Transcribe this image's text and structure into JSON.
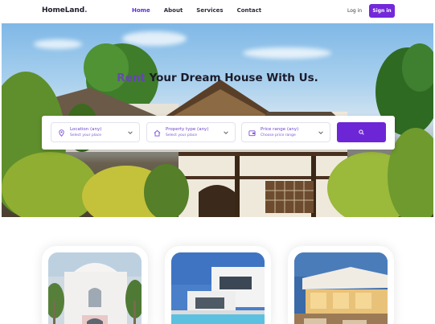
{
  "header": {
    "logo": "HomeLand",
    "nav": [
      {
        "label": "Home",
        "active": true
      },
      {
        "label": "About",
        "active": false
      },
      {
        "label": "Services",
        "active": false
      },
      {
        "label": "Contact",
        "active": false
      }
    ],
    "login_label": "Log in",
    "signin_label": "Sign in"
  },
  "hero": {
    "title_accent": "Rent",
    "title_rest": " Your Dream House With Us."
  },
  "search": {
    "fields": [
      {
        "label": "Location (any)",
        "sub": "Select your place",
        "icon": "location-pin-icon"
      },
      {
        "label": "Property type (any)",
        "sub": "Select your place",
        "icon": "home-icon"
      },
      {
        "label": "Price range (any)",
        "sub": "Choose price range",
        "icon": "wallet-icon"
      }
    ],
    "button_icon": "search-icon"
  },
  "colors": {
    "brand": "#7328d9",
    "active_nav": "#5a2fd6",
    "field_text": "#6b45c8"
  }
}
